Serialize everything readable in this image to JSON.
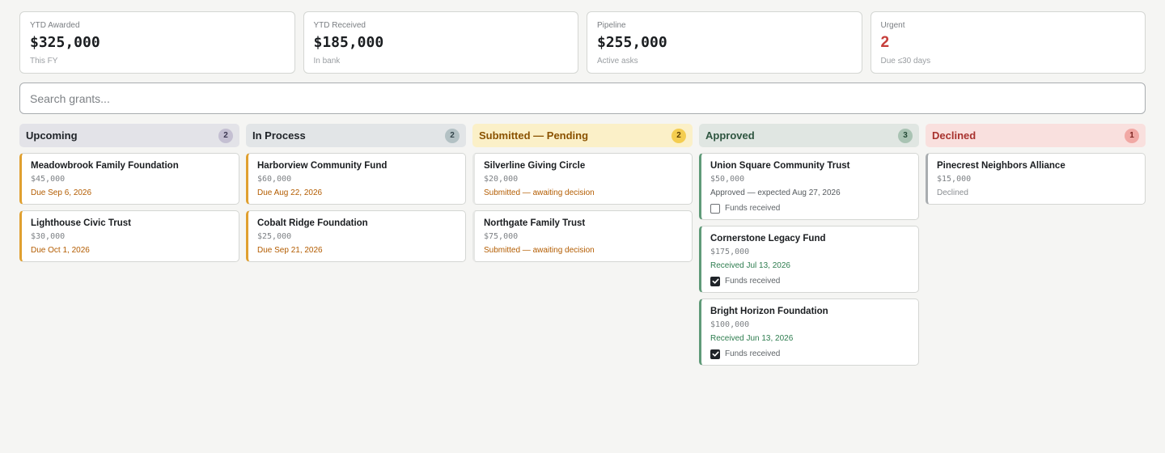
{
  "stats": [
    {
      "label": "YTD Awarded",
      "value": "$325,000",
      "sub": "This FY"
    },
    {
      "label": "YTD Received",
      "value": "$185,000",
      "sub": "In bank"
    },
    {
      "label": "Pipeline",
      "value": "$255,000",
      "sub": "Active asks"
    },
    {
      "label": "Urgent",
      "value": "2",
      "sub": "Due ≤30 days"
    }
  ],
  "search": {
    "placeholder": "Search grants..."
  },
  "columns": [
    {
      "title": "Upcoming",
      "count": "2",
      "colors": {
        "head_bg": "#e3e3e8",
        "title": "#1f2328",
        "badge_bg": "#c4bfd2",
        "badge_text": "#3a3550",
        "accent": "#e0a030",
        "status": "#b35c00"
      },
      "cards": [
        {
          "title": "Meadowbrook Family Foundation",
          "amount": "$45,000",
          "status": "Due Sep 6, 2026"
        },
        {
          "title": "Lighthouse Civic Trust",
          "amount": "$30,000",
          "status": "Due Oct 1, 2026"
        }
      ]
    },
    {
      "title": "In Process",
      "count": "2",
      "colors": {
        "head_bg": "#e2e5e7",
        "title": "#1f2328",
        "badge_bg": "#b3c1c4",
        "badge_text": "#33444a",
        "accent": "#e0a030",
        "status": "#b35c00"
      },
      "cards": [
        {
          "title": "Harborview Community Fund",
          "amount": "$60,000",
          "status": "Due Aug 22, 2026"
        },
        {
          "title": "Cobalt Ridge Foundation",
          "amount": "$25,000",
          "status": "Due Sep 21, 2026"
        }
      ]
    },
    {
      "title": "Submitted — Pending",
      "count": "2",
      "colors": {
        "head_bg": "#fbf0c8",
        "title": "#8a5200",
        "badge_bg": "#f4cd4f",
        "badge_text": "#5a3e00",
        "accent": "#e6e7e5",
        "status": "#b35c00"
      },
      "cards": [
        {
          "title": "Silverline Giving Circle",
          "amount": "$20,000",
          "status": "Submitted — awaiting decision"
        },
        {
          "title": "Northgate Family Trust",
          "amount": "$75,000",
          "status": "Submitted — awaiting decision"
        }
      ]
    },
    {
      "title": "Approved",
      "count": "3",
      "colors": {
        "head_bg": "#e0e6e2",
        "title": "#2e5540",
        "badge_bg": "#a9c3b3",
        "badge_text": "#244a36",
        "accent": "#5f9a78",
        "status": "#555a5e"
      },
      "cards": [
        {
          "title": "Union Square Community Trust",
          "amount": "$50,000",
          "status": "Approved — expected Aug 27, 2026",
          "funds_label": "Funds received",
          "funds_received": false
        },
        {
          "title": "Cornerstone Legacy Fund",
          "amount": "$175,000",
          "status": "Received Jul 13, 2026",
          "funds_label": "Funds received",
          "funds_received": true
        },
        {
          "title": "Bright Horizon Foundation",
          "amount": "$100,000",
          "status": "Received Jun 13, 2026",
          "funds_label": "Funds received",
          "funds_received": true
        }
      ]
    },
    {
      "title": "Declined",
      "count": "1",
      "colors": {
        "head_bg": "#f9e0de",
        "title": "#a8322e",
        "badge_bg": "#f1a8a4",
        "badge_text": "#7a2420",
        "accent": "#a9adb0",
        "status": "#8a8e92"
      },
      "cards": [
        {
          "title": "Pinecrest Neighbors Alliance",
          "amount": "$15,000",
          "status": "Declined"
        }
      ]
    }
  ],
  "colors": {
    "received_status": "#2e7d4f",
    "urgent": "#c63d3a"
  }
}
